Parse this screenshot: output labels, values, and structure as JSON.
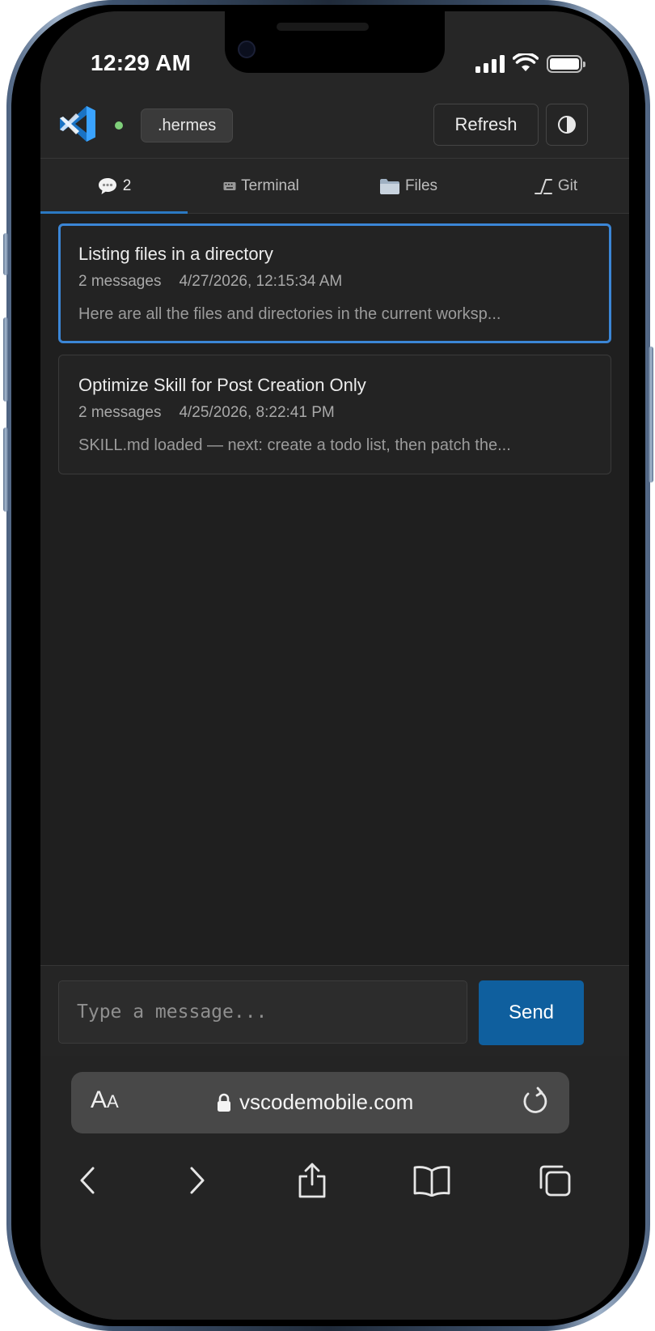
{
  "status_bar": {
    "time": "12:29 AM",
    "signal": "signal-bars-icon",
    "wifi": "wifi-icon",
    "battery": "battery-full-icon"
  },
  "header": {
    "logo": "vscode-logo-icon",
    "connection": "connected",
    "project": ".hermes",
    "refresh_label": "Refresh",
    "theme_icon": "contrast-icon"
  },
  "tabs": [
    {
      "label": "2",
      "icon": "chat-bubble-icon",
      "active": true
    },
    {
      "label": "Terminal",
      "icon": "keyboard-icon",
      "active": false
    },
    {
      "label": "Files",
      "icon": "folder-icon",
      "active": false
    },
    {
      "label": "Git",
      "icon": "git-branch-icon",
      "active": false
    }
  ],
  "sessions": [
    {
      "title": "Listing files in a directory",
      "count": "2 messages",
      "date": "4/27/2026, 12:15:34 AM",
      "preview": "Here are all the files and directories in the current worksp...",
      "selected": true
    },
    {
      "title": "Optimize Skill for Post Creation Only",
      "count": "2 messages",
      "date": "4/25/2026, 8:22:41 PM",
      "preview": "SKILL.md loaded — next: create a todo list, then patch the...",
      "selected": false
    }
  ],
  "composer": {
    "placeholder": "Type a message...",
    "value": "",
    "send_label": "Send"
  },
  "browser": {
    "text_size": {
      "big": "A",
      "small": "A"
    },
    "url": "vscodemobile.com",
    "nav": [
      "back-icon",
      "forward-icon",
      "share-icon",
      "bookmarks-icon",
      "tabs-icon"
    ]
  },
  "colors": {
    "accent": "#2b79c2",
    "send": "#0f5f9e",
    "selected_border": "#3b86d6",
    "status_dot": "#7fcf7a",
    "background": "#1f1f1f"
  }
}
